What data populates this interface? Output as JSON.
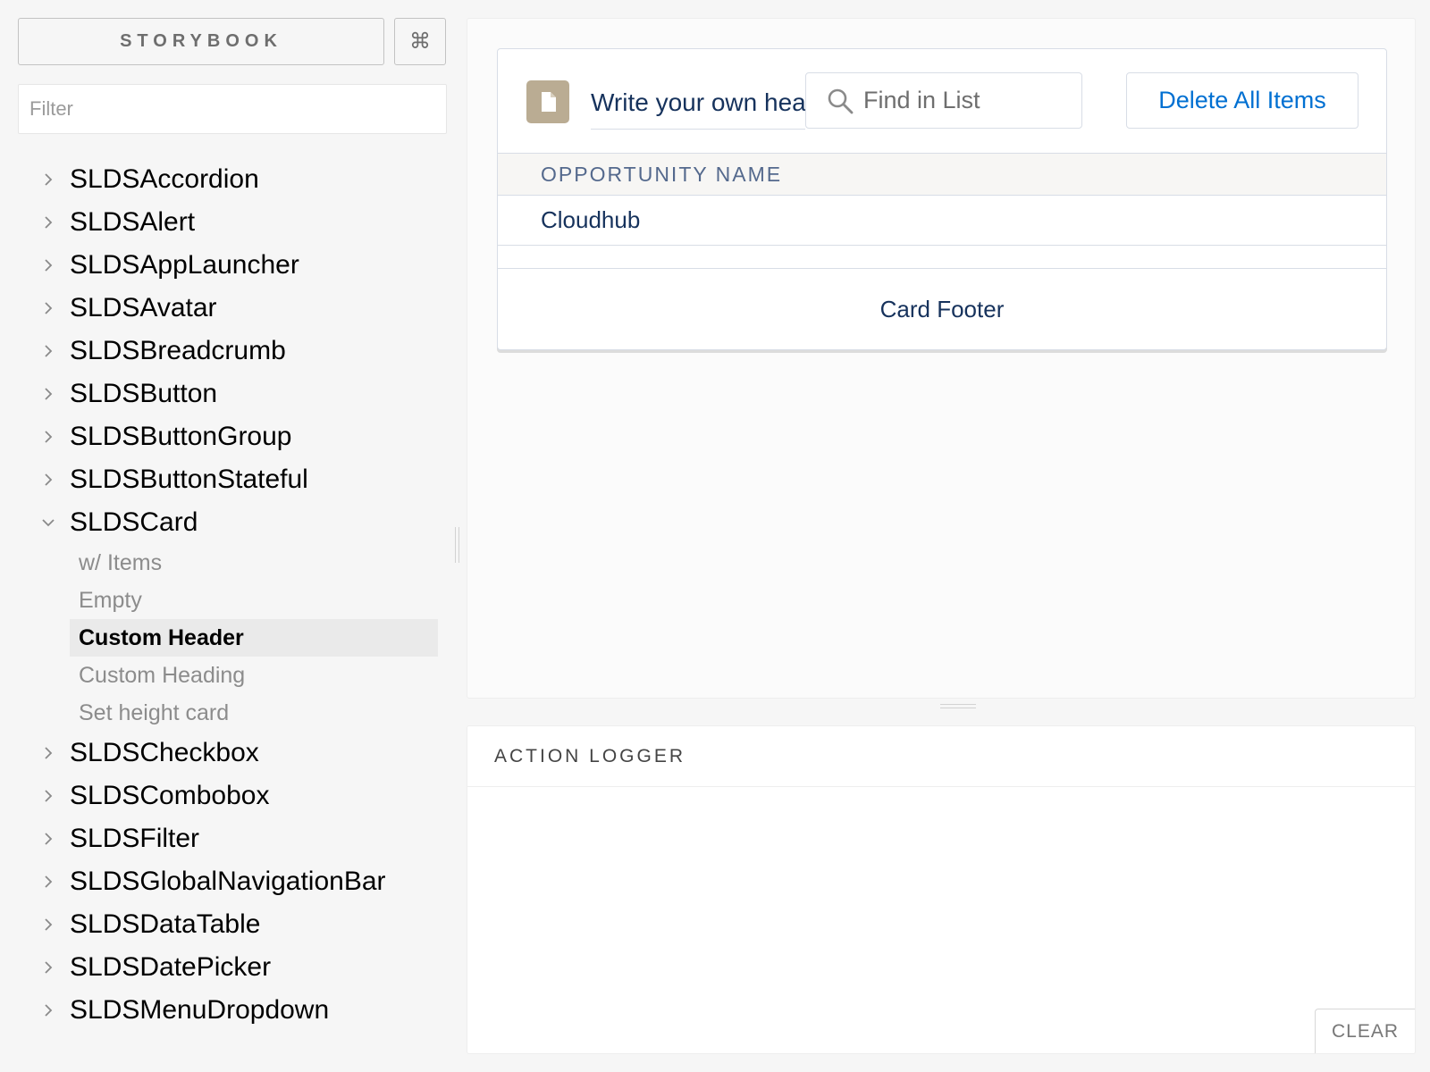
{
  "sidebar": {
    "title": "STORYBOOK",
    "shortcuts_label": "⌘",
    "filter_placeholder": "Filter",
    "kinds_before": [
      {
        "label": "SLDSAccordion"
      },
      {
        "label": "SLDSAlert"
      },
      {
        "label": "SLDSAppLauncher"
      },
      {
        "label": "SLDSAvatar"
      },
      {
        "label": "SLDSBreadcrumb"
      },
      {
        "label": "SLDSButton"
      },
      {
        "label": "SLDSButtonGroup"
      },
      {
        "label": "SLDSButtonStateful"
      }
    ],
    "expanded_kind": {
      "label": "SLDSCard",
      "stories": [
        {
          "label": "w/ Items",
          "active": false
        },
        {
          "label": "Empty",
          "active": false
        },
        {
          "label": "Custom Header",
          "active": true
        },
        {
          "label": "Custom Heading",
          "active": false
        },
        {
          "label": "Set height card",
          "active": false
        }
      ]
    },
    "kinds_after": [
      {
        "label": "SLDSCheckbox"
      },
      {
        "label": "SLDSCombobox"
      },
      {
        "label": "SLDSFilter"
      },
      {
        "label": "SLDSGlobalNavigationBar"
      },
      {
        "label": "SLDSDataTable"
      },
      {
        "label": "SLDSDatePicker"
      },
      {
        "label": "SLDSMenuDropdown"
      }
    ]
  },
  "card": {
    "header_input_value": "Write your own heading",
    "search_placeholder": "Find in List",
    "delete_button": "Delete All Items",
    "column_header": "OPPORTUNITY NAME",
    "rows": [
      "Cloudhub",
      ""
    ],
    "footer": "Card Footer"
  },
  "logger": {
    "tab_label": "ACTION LOGGER",
    "clear_button": "CLEAR"
  },
  "colors": {
    "accent_blue": "#0070d2",
    "doc_icon_bg": "#baac93"
  }
}
